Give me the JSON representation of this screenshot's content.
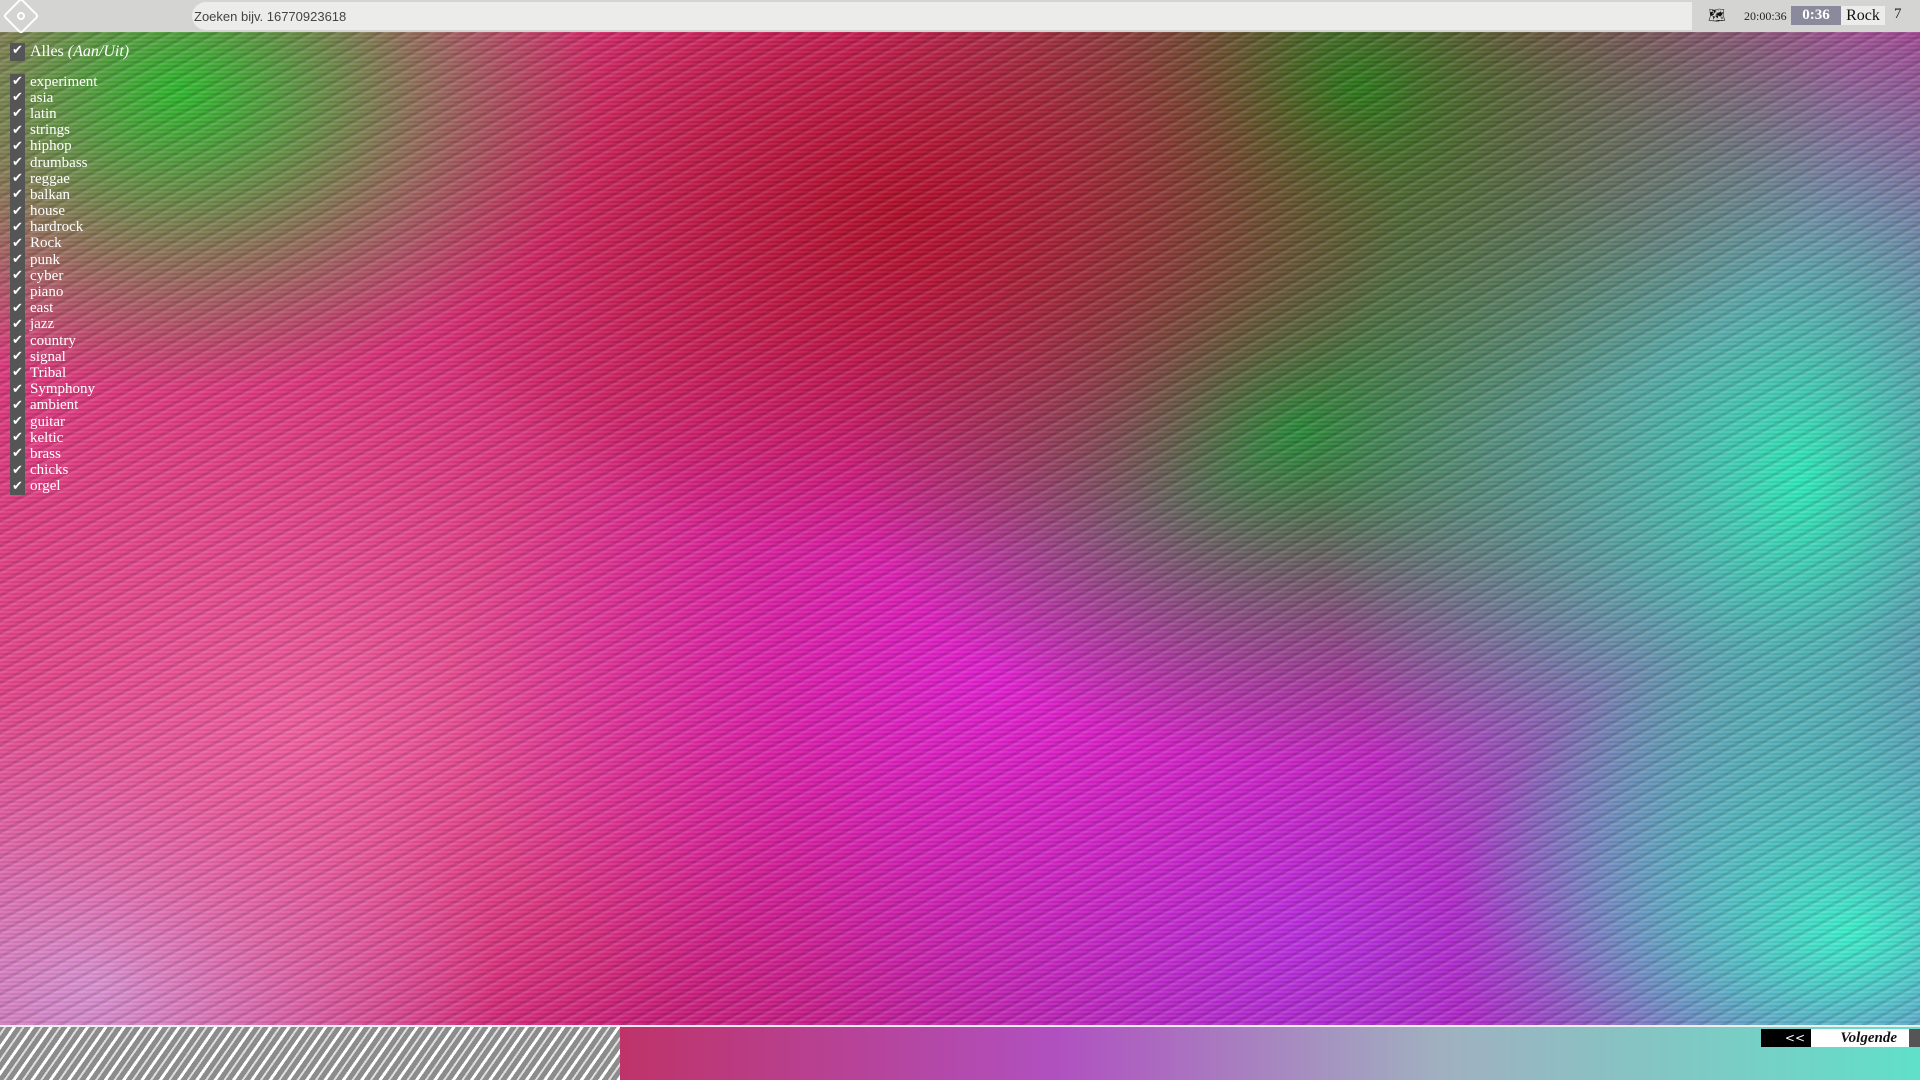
{
  "header": {
    "logo": "app-logo",
    "search_placeholder": "Zoeken bijv. 16770923618",
    "world_icon": "world-map-icon",
    "clock": "20:00:36",
    "timer": "0:36",
    "genre": "Rock",
    "count": "7"
  },
  "filters": {
    "all_label": "Alles",
    "all_toggle": "(Aan/Uit)",
    "items": [
      "experiment",
      "asia",
      "latin",
      "strings",
      "hiphop",
      "drumbass",
      "reggae",
      "balkan",
      "house",
      "hardrock",
      "Rock",
      "punk",
      "cyber",
      "piano",
      "east",
      "jazz",
      "country",
      "signal",
      "Tribal",
      "Symphony",
      "ambient",
      "guitar",
      "keltic",
      "brass",
      "chicks",
      "orgel"
    ],
    "all_checked": true
  },
  "footer": {
    "prev_label": "<<",
    "next_label": "Volgende",
    "progress_fraction": 0.323
  },
  "colors": {
    "topbar": "#d4d4d2",
    "timer_bg": "#8a8a9c",
    "checkbox": "#555555"
  }
}
